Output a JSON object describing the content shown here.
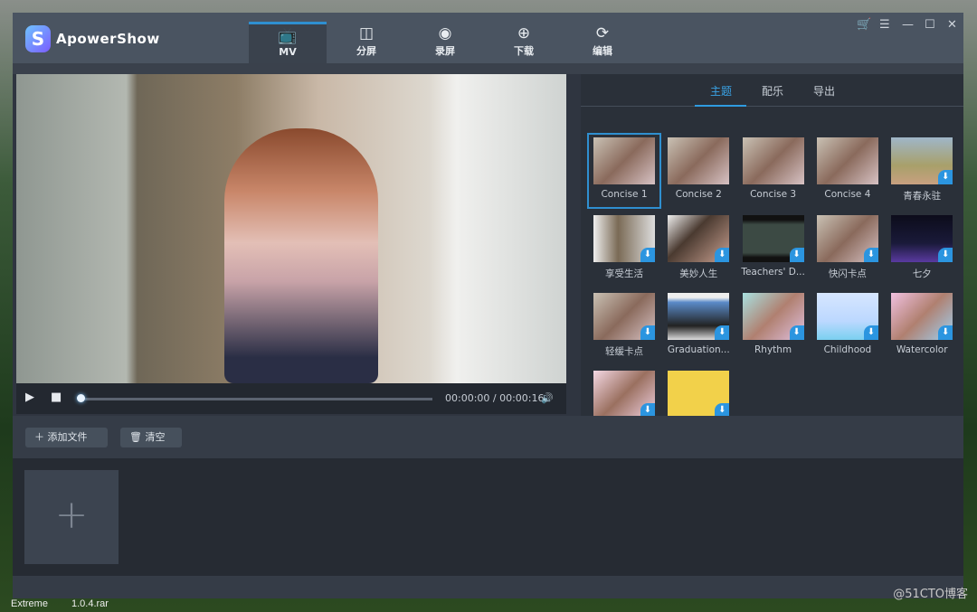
{
  "desktop": {
    "labels": [
      "Extreme",
      "1.0.4.rar"
    ],
    "watermark": "@51CTO博客"
  },
  "app": {
    "name": "ApowerShow",
    "logo_letter": "S"
  },
  "nav": [
    {
      "label": "MV",
      "icon": "tv-icon",
      "glyph": "📺",
      "active": true
    },
    {
      "label": "分屏",
      "icon": "split-screen-icon",
      "glyph": "◫"
    },
    {
      "label": "录屏",
      "icon": "record-icon",
      "glyph": "◉"
    },
    {
      "label": "下载",
      "icon": "download-icon",
      "glyph": "⊕"
    },
    {
      "label": "编辑",
      "icon": "refresh-icon",
      "glyph": "⟳"
    }
  ],
  "window_controls": [
    {
      "name": "cart-icon",
      "glyph": "🛒"
    },
    {
      "name": "menu-icon",
      "glyph": "☰"
    },
    {
      "name": "minimize-icon",
      "glyph": "—"
    },
    {
      "name": "maximize-icon",
      "glyph": "☐"
    },
    {
      "name": "close-icon",
      "glyph": "✕"
    }
  ],
  "player": {
    "time": "00:00:00 / 00:00:16",
    "progress": 0,
    "play": "▶",
    "stop": "■",
    "volume": "🔊"
  },
  "panel": {
    "tabs": [
      {
        "label": "主题",
        "active": true
      },
      {
        "label": "配乐"
      },
      {
        "label": "导出"
      }
    ],
    "themes": [
      {
        "label": "Concise 1",
        "selected": true,
        "download": false
      },
      {
        "label": "Concise 2",
        "download": false
      },
      {
        "label": "Concise 3",
        "download": false
      },
      {
        "label": "Concise 4",
        "download": false
      },
      {
        "label": "青春永驻",
        "download": true
      },
      {
        "label": "享受生活",
        "download": true
      },
      {
        "label": "美妙人生",
        "download": true
      },
      {
        "label": "Teachers' D...",
        "download": true
      },
      {
        "label": "快闪卡点",
        "download": true
      },
      {
        "label": "七夕",
        "download": true
      },
      {
        "label": "轻缓卡点",
        "download": true
      },
      {
        "label": "Graduation...",
        "download": true
      },
      {
        "label": "Rhythm",
        "download": true
      },
      {
        "label": "Childhood",
        "download": true
      },
      {
        "label": "Watercolor",
        "download": true
      },
      {
        "label": "",
        "download": true
      },
      {
        "label": "",
        "download": true
      }
    ]
  },
  "toolbar": {
    "add_files": "添加文件",
    "clear": "清空"
  },
  "colors": {
    "accent": "#2f8fd0"
  }
}
